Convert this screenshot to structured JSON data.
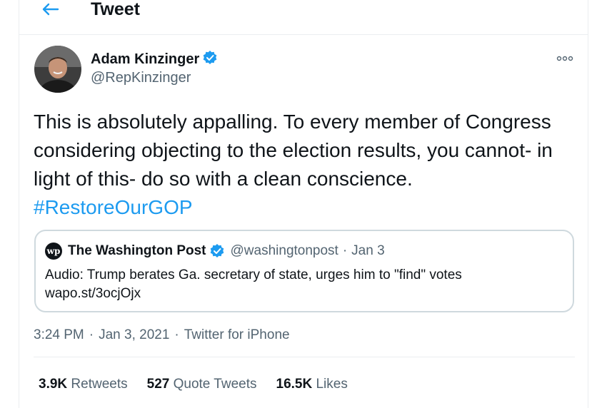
{
  "header": {
    "title": "Tweet",
    "back_icon": "arrow-left-icon"
  },
  "author": {
    "name": "Adam Kinzinger",
    "handle": "@RepKinzinger",
    "verified": true,
    "avatar_icon": "avatar"
  },
  "tweet": {
    "text": "This is absolutely appalling.  To every member of Congress considering objecting to the election results, you cannot- in light of this- do so with a clean conscience. ",
    "hashtag": "#RestoreOurGOP"
  },
  "quote": {
    "logo_text": "wp",
    "name": "The Washington Post",
    "verified": true,
    "handle": "@washingtonpost",
    "dot": "·",
    "date": "Jan 3",
    "text": "Audio: Trump berates Ga. secretary of state, urges him to \"find\" votes",
    "link": "wapo.st/3ocjOjx"
  },
  "meta": {
    "time": "3:24 PM",
    "sep1": "·",
    "date": "Jan 3, 2021",
    "sep2": "·",
    "source": "Twitter for iPhone"
  },
  "stats": [
    {
      "value": "3.9K",
      "label": "Retweets"
    },
    {
      "value": "527",
      "label": "Quote Tweets"
    },
    {
      "value": "16.5K",
      "label": "Likes"
    }
  ],
  "colors": {
    "accent": "#1d9bf0",
    "text": "#0f1419",
    "secondary": "#536471",
    "border": "#cfd9de"
  }
}
